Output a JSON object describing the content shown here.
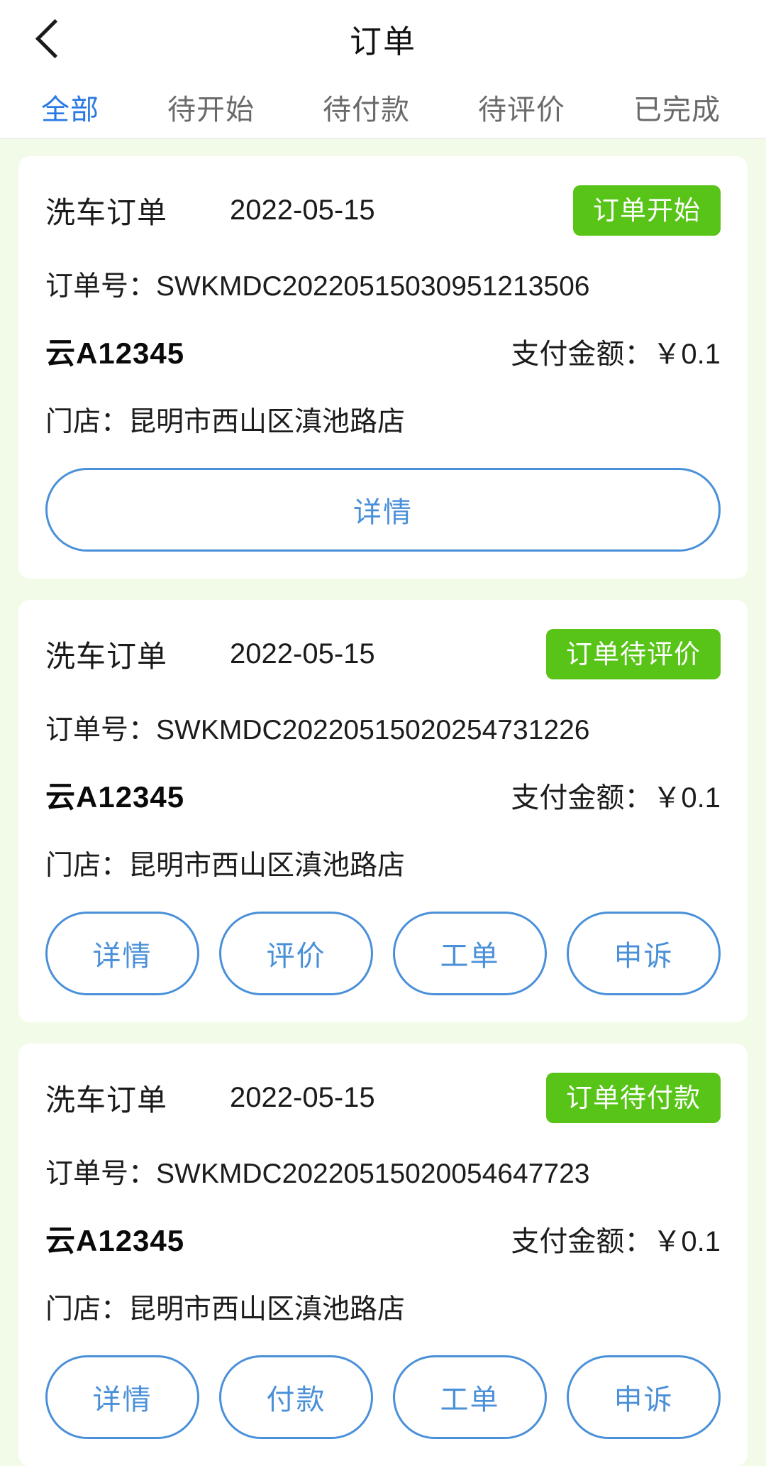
{
  "header": {
    "title": "订单",
    "back_icon": "chevron-left-icon"
  },
  "tabs": [
    {
      "label": "全部",
      "active": true
    },
    {
      "label": "待开始",
      "active": false
    },
    {
      "label": "待付款",
      "active": false
    },
    {
      "label": "待评价",
      "active": false
    },
    {
      "label": "已完成",
      "active": false
    }
  ],
  "labels": {
    "order_no_prefix": "订单号：",
    "pay_amount_prefix": "支付金额：",
    "store_prefix": "门店："
  },
  "colors": {
    "page_background": "#f2fbe8",
    "card_background": "#ffffff",
    "status_green": "#57c417",
    "active_tab_blue": "#2979e3",
    "outline_button_blue": "#4a90d9"
  },
  "orders": [
    {
      "type": "洗车订单",
      "date": "2022-05-15",
      "status": "订单开始",
      "order_no": "订单号：SWKMDC20220515030951213506",
      "plate": "云A12345",
      "pay_amount": "支付金额：￥0.1",
      "store": "门店：昆明市西山区滇池路店",
      "actions": [
        "详情"
      ]
    },
    {
      "type": "洗车订单",
      "date": "2022-05-15",
      "status": "订单待评价",
      "order_no": "订单号：SWKMDC20220515020254731226",
      "plate": "云A12345",
      "pay_amount": "支付金额：￥0.1",
      "store": "门店：昆明市西山区滇池路店",
      "actions": [
        "详情",
        "评价",
        "工单",
        "申诉"
      ]
    },
    {
      "type": "洗车订单",
      "date": "2022-05-15",
      "status": "订单待付款",
      "order_no": "订单号：SWKMDC20220515020054647723",
      "plate": "云A12345",
      "pay_amount": "支付金额：￥0.1",
      "store": "门店：昆明市西山区滇池路店",
      "actions": [
        "详情",
        "付款",
        "工单",
        "申诉"
      ]
    }
  ]
}
